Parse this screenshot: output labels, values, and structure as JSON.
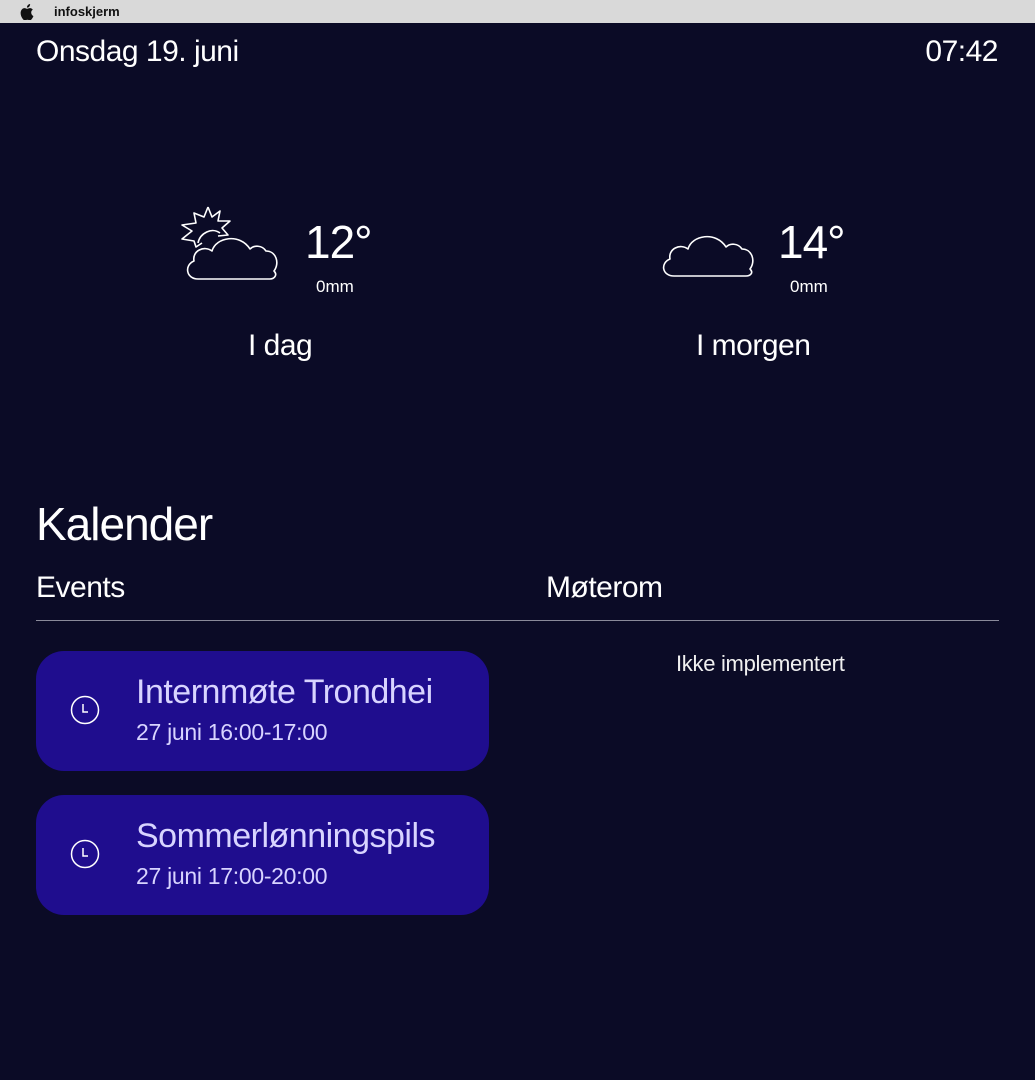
{
  "menubar": {
    "icon": "apple-icon",
    "app_name": "infoskjerm"
  },
  "header": {
    "date": "Onsdag 19. juni",
    "time": "07:42"
  },
  "weather": {
    "today": {
      "icon": "partly-sunny-icon",
      "temperature": "12°",
      "precipitation": "0mm",
      "label": "I dag"
    },
    "tomorrow": {
      "icon": "cloud-icon",
      "temperature": "14°",
      "precipitation": "0mm",
      "label": "I morgen"
    }
  },
  "calendar": {
    "title": "Kalender",
    "events_heading": "Events",
    "rooms_heading": "Møterom",
    "rooms_status": "Ikke implementert",
    "events": [
      {
        "icon": "clock-icon",
        "title": "Internmøte Trondhei",
        "time": "27 juni 16:00-17:00"
      },
      {
        "icon": "clock-icon",
        "title": "Sommerlønningspils",
        "time": "27 juni 17:00-20:00"
      }
    ]
  },
  "colors": {
    "background": "#0b0b26",
    "card": "#1f0d8e",
    "card_text": "#d8d4ff",
    "text": "#ffffff",
    "menubar": "#d9d9d9"
  }
}
